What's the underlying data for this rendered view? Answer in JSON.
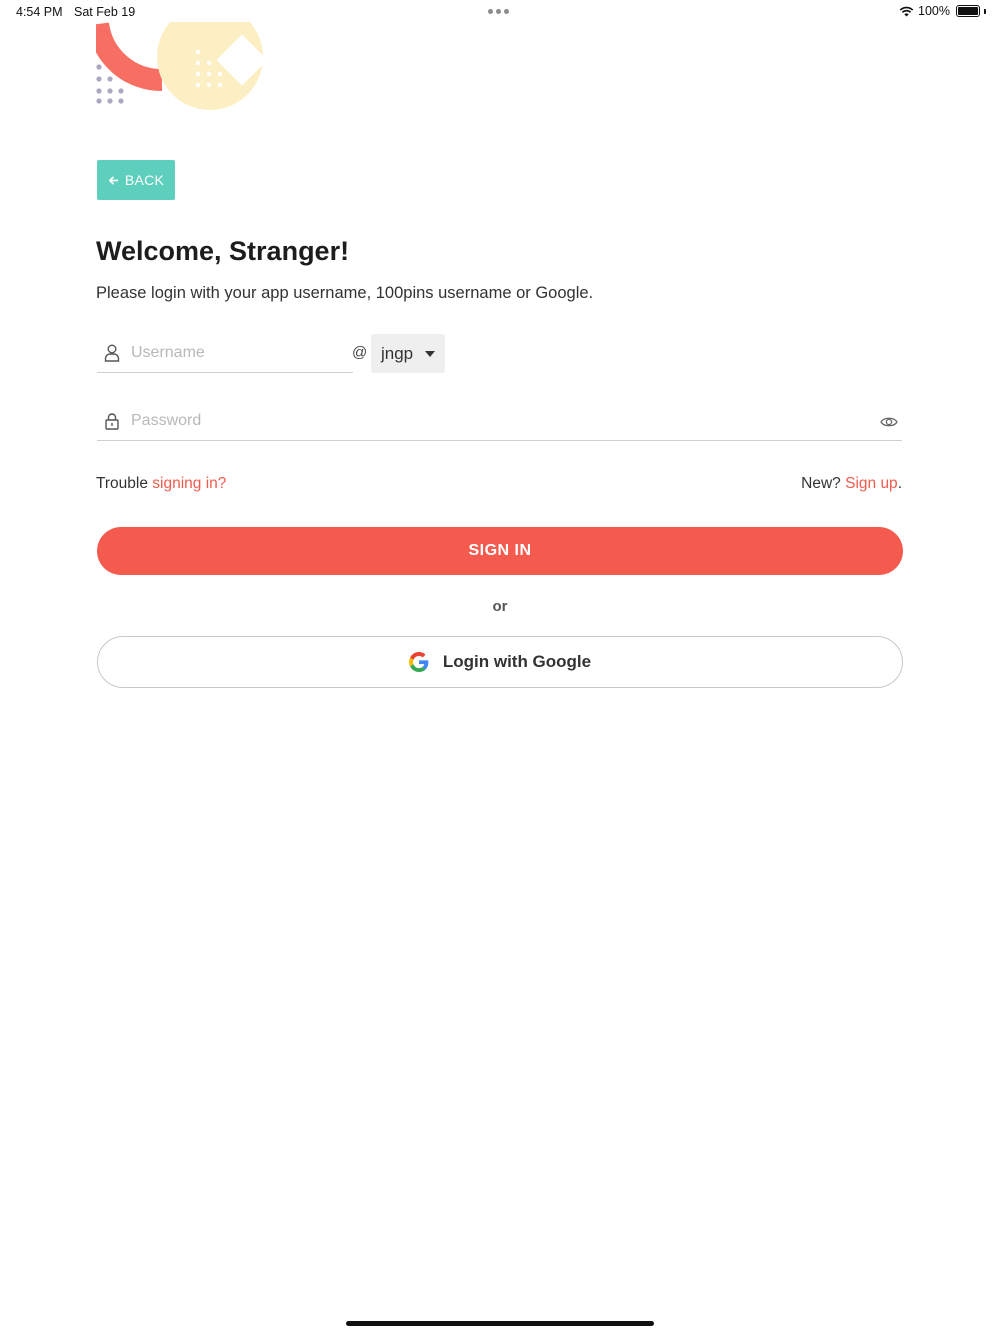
{
  "status_bar": {
    "time": "4:54 PM",
    "date": "Sat Feb 19",
    "battery": "100%"
  },
  "back_button": {
    "label": "BACK"
  },
  "welcome": {
    "title": "Welcome, Stranger!",
    "subtitle": "Please login with your app username, 100pins username or Google."
  },
  "form": {
    "username_placeholder": "Username",
    "at_sign": "@",
    "domain_selected": "jngp",
    "password_placeholder": "Password"
  },
  "links": {
    "trouble_prefix": "Trouble ",
    "trouble_link": "signing in?",
    "new_prefix": "New? ",
    "signup_link": "Sign up",
    "signup_suffix": "."
  },
  "sign_in_button": {
    "label": "SIGN IN"
  },
  "divider": {
    "text": "or"
  },
  "google_button": {
    "label": "Login with Google"
  },
  "colors": {
    "accent": "#f55a4e",
    "back_button": "#5ecfbc",
    "decor_yellow": "#fdefc4"
  }
}
